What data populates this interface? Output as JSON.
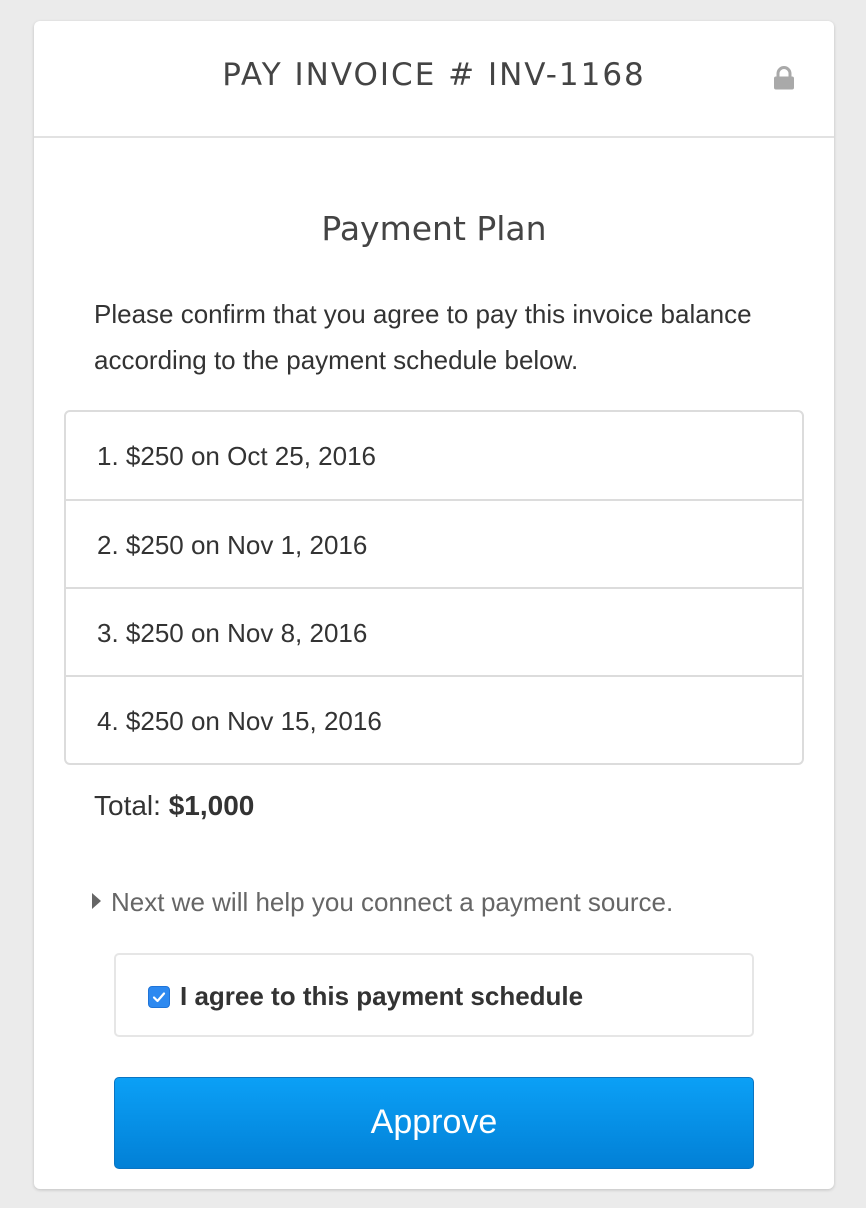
{
  "header": {
    "title": "PAY INVOICE # INV-1168",
    "lock_icon": "lock-icon"
  },
  "plan": {
    "title": "Payment Plan",
    "intro": "Please confirm that you agree to pay this invoice balance according to the payment schedule below.",
    "schedule": [
      "1. $250 on Oct 25, 2016",
      "2. $250 on Nov 1, 2016",
      "3. $250 on Nov 8, 2016",
      "4. $250 on Nov 15, 2016"
    ],
    "total_label": "Total:",
    "total_value": "$1,000"
  },
  "next_note": "Next we will help you connect a payment source.",
  "agreement": {
    "label": "I agree to this payment schedule",
    "checked": true
  },
  "approve_button": "Approve",
  "colors": {
    "accent": "#0a8ee8",
    "checkbox": "#2d89f0",
    "background": "#ebebeb"
  }
}
